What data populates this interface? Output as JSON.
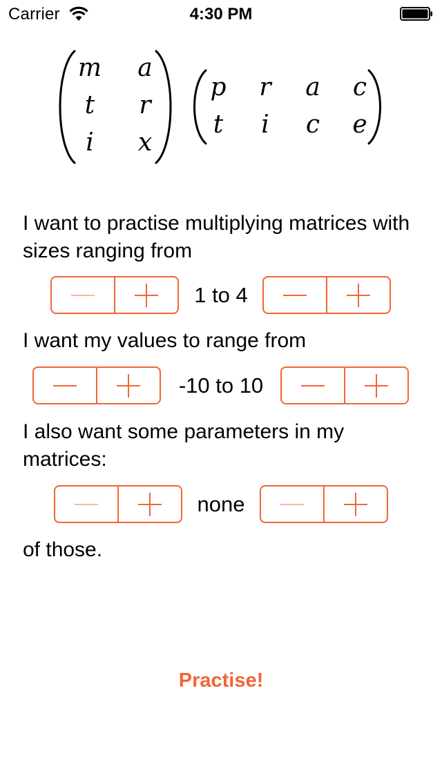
{
  "status_bar": {
    "carrier": "Carrier",
    "time": "4:30 PM"
  },
  "title_matrices": {
    "left_matrix": [
      [
        "m",
        "a"
      ],
      [
        "t",
        "r"
      ],
      [
        "i",
        "x"
      ]
    ],
    "right_matrix": [
      [
        "p",
        "r",
        "a",
        "c"
      ],
      [
        "t",
        "i",
        "c",
        "e"
      ]
    ]
  },
  "settings": {
    "sizes_prompt": "I want to practise multiplying matrices with sizes ranging from",
    "sizes_value": "1 to 4",
    "values_prompt": "I want my values to range from",
    "values_value": "-10 to 10",
    "parameters_prompt": "I also want some parameters in my matrices:",
    "parameters_value": "none",
    "parameters_suffix": "of those."
  },
  "practise_label": "Practise!",
  "colors": {
    "accent": "#f26535",
    "accent_disabled": "#f8b9a0"
  },
  "icons": {
    "decrement": "minus-icon",
    "increment": "plus-icon",
    "wifi": "wifi-icon",
    "battery": "battery-icon"
  },
  "stepper_states": {
    "sizes_min": {
      "decrement_enabled": false,
      "increment_enabled": true
    },
    "sizes_max": {
      "decrement_enabled": true,
      "increment_enabled": true
    },
    "values_min": {
      "decrement_enabled": true,
      "increment_enabled": true
    },
    "values_max": {
      "decrement_enabled": true,
      "increment_enabled": true
    },
    "parameters_min": {
      "decrement_enabled": false,
      "increment_enabled": true
    },
    "parameters_max": {
      "decrement_enabled": false,
      "increment_enabled": true
    }
  }
}
